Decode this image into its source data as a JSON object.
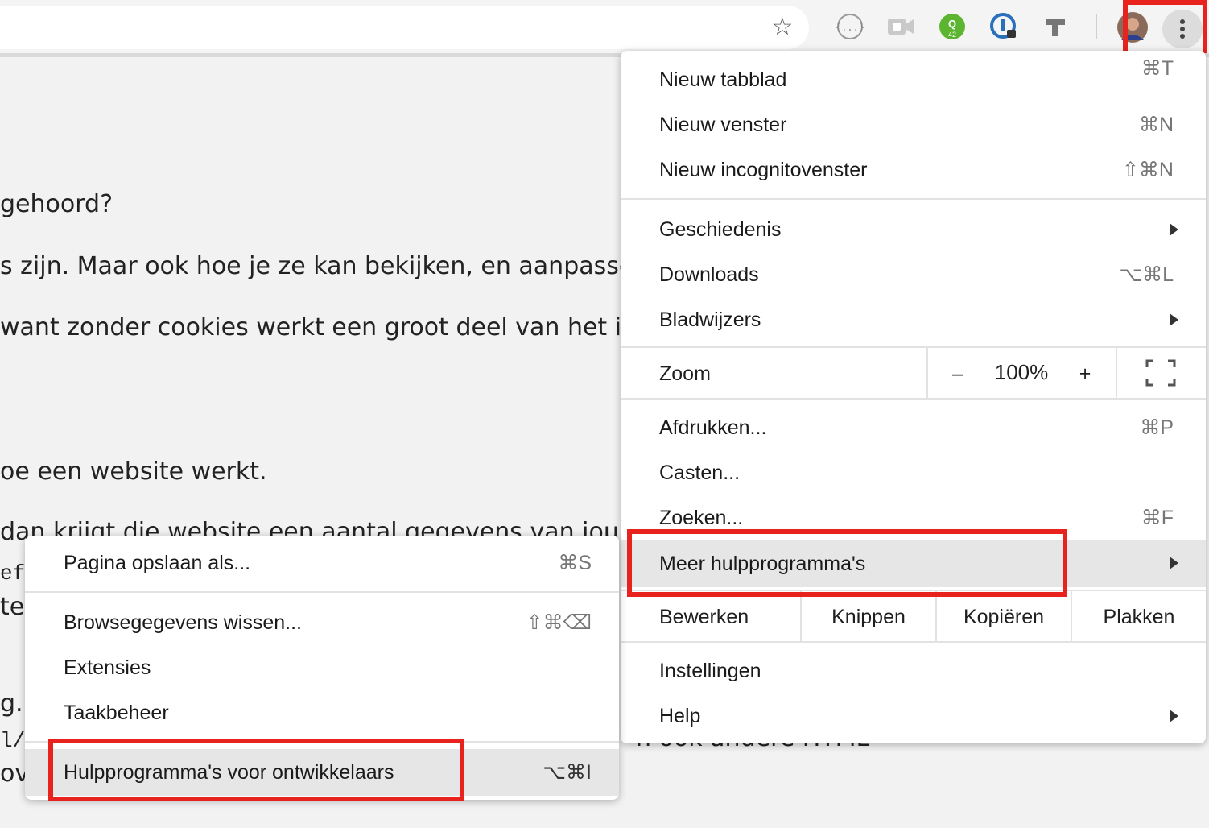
{
  "menu": {
    "new_tab": {
      "label": "Nieuw tabblad",
      "shortcut": "⌘T"
    },
    "new_window": {
      "label": "Nieuw venster",
      "shortcut": "⌘N"
    },
    "incognito": {
      "label": "Nieuw incognitovenster",
      "shortcut": "⇧⌘N"
    },
    "history": {
      "label": "Geschiedenis"
    },
    "downloads": {
      "label": "Downloads",
      "shortcut": "⌥⌘L"
    },
    "bookmarks": {
      "label": "Bladwijzers"
    },
    "zoom": {
      "label": "Zoom",
      "minus": "–",
      "value": "100%",
      "plus": "+"
    },
    "print": {
      "label": "Afdrukken...",
      "shortcut": "⌘P"
    },
    "cast": {
      "label": "Casten..."
    },
    "find": {
      "label": "Zoeken...",
      "shortcut": "⌘F"
    },
    "more_tools": {
      "label": "Meer hulpprogramma's"
    },
    "edit": {
      "label": "Bewerken",
      "cut": "Knippen",
      "copy": "Kopiëren",
      "paste": "Plakken"
    },
    "settings": {
      "label": "Instellingen"
    },
    "help": {
      "label": "Help"
    }
  },
  "submenu": {
    "save_page": {
      "label": "Pagina opslaan als...",
      "shortcut": "⌘S"
    },
    "clear_data": {
      "label": "Browsegegevens wissen...",
      "shortcut": "⇧⌘⌫"
    },
    "extensions": {
      "label": "Extensies"
    },
    "task_manager": {
      "label": "Taakbeheer"
    },
    "dev_tools": {
      "label": "Hulpprogramma's voor ontwikkelaars",
      "shortcut": "⌥⌘I"
    }
  },
  "page_text": {
    "line1": "gehoord?",
    "line2": "s zijn. Maar ook hoe je ze kan bekijken, en aanpassen.",
    "line3": "want zonder cookies werkt een groot deel van het inter",
    "line4": "oe een website werkt.",
    "line5": "dan krijgt die website een aantal gegevens van jou. Na",
    "line6": "ef",
    "line7": "te",
    "line8": "g. I",
    "line9": "l/c",
    "line10": "ov",
    "line11": "n ook andere HTML"
  },
  "extension_badge": "42",
  "colors": {
    "highlight_red": "#e8231d",
    "menu_hover": "#e6e6e6",
    "ext_green": "#5cb531"
  }
}
